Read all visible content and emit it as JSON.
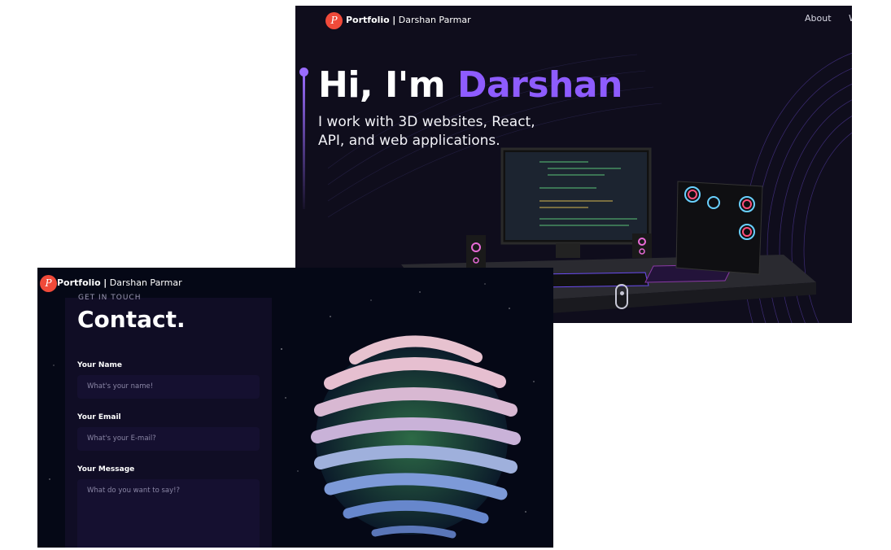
{
  "hero": {
    "brand": {
      "logo_letter": "P",
      "bold": "Portfolio",
      "separator": "|",
      "name": "Darshan Parmar"
    },
    "nav": [
      {
        "label": "About"
      },
      {
        "label": "W"
      }
    ],
    "title_prefix": "Hi, I'm ",
    "title_highlight": "Darshan",
    "subtitle": "I work with 3D websites, React, API, and web applications.",
    "accent_color": "#8e5cff",
    "scene_icon": "computer-desk-icon"
  },
  "contact": {
    "brand": {
      "logo_letter": "P",
      "bold": "Portfolio",
      "separator": "|",
      "name": "Darshan Parmar"
    },
    "eyebrow": "GET IN TOUCH",
    "title": "Contact.",
    "fields": [
      {
        "label": "Your Name",
        "placeholder": "What's your name!"
      },
      {
        "label": "Your Email",
        "placeholder": "What's your E-mail?"
      },
      {
        "label": "Your Message",
        "placeholder": "What do you want to say!?"
      }
    ],
    "scene_icon": "globe-icon"
  }
}
